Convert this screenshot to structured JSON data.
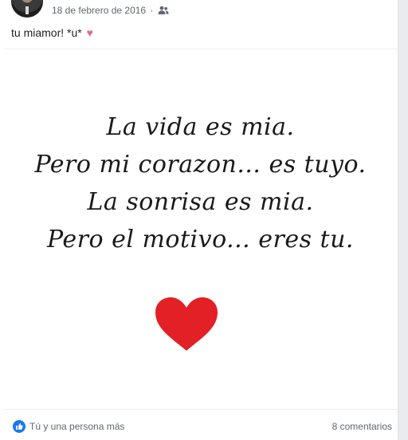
{
  "post": {
    "date": "18 de febrero de 2016",
    "separator": "·",
    "audience_icon": "friends-icon",
    "caption": "tu miamor! *u*",
    "caption_emoji": "♥"
  },
  "image": {
    "lines": [
      "La vida es mia.",
      "Pero mi corazon... es tuyo.",
      "La sonrisa es mia.",
      "Pero el motivo... eres tu."
    ],
    "heart_color": "#e32025"
  },
  "footer": {
    "reactions": "Tú y una persona más",
    "comments": "8 comentarios",
    "like_color": "#1877f2"
  }
}
